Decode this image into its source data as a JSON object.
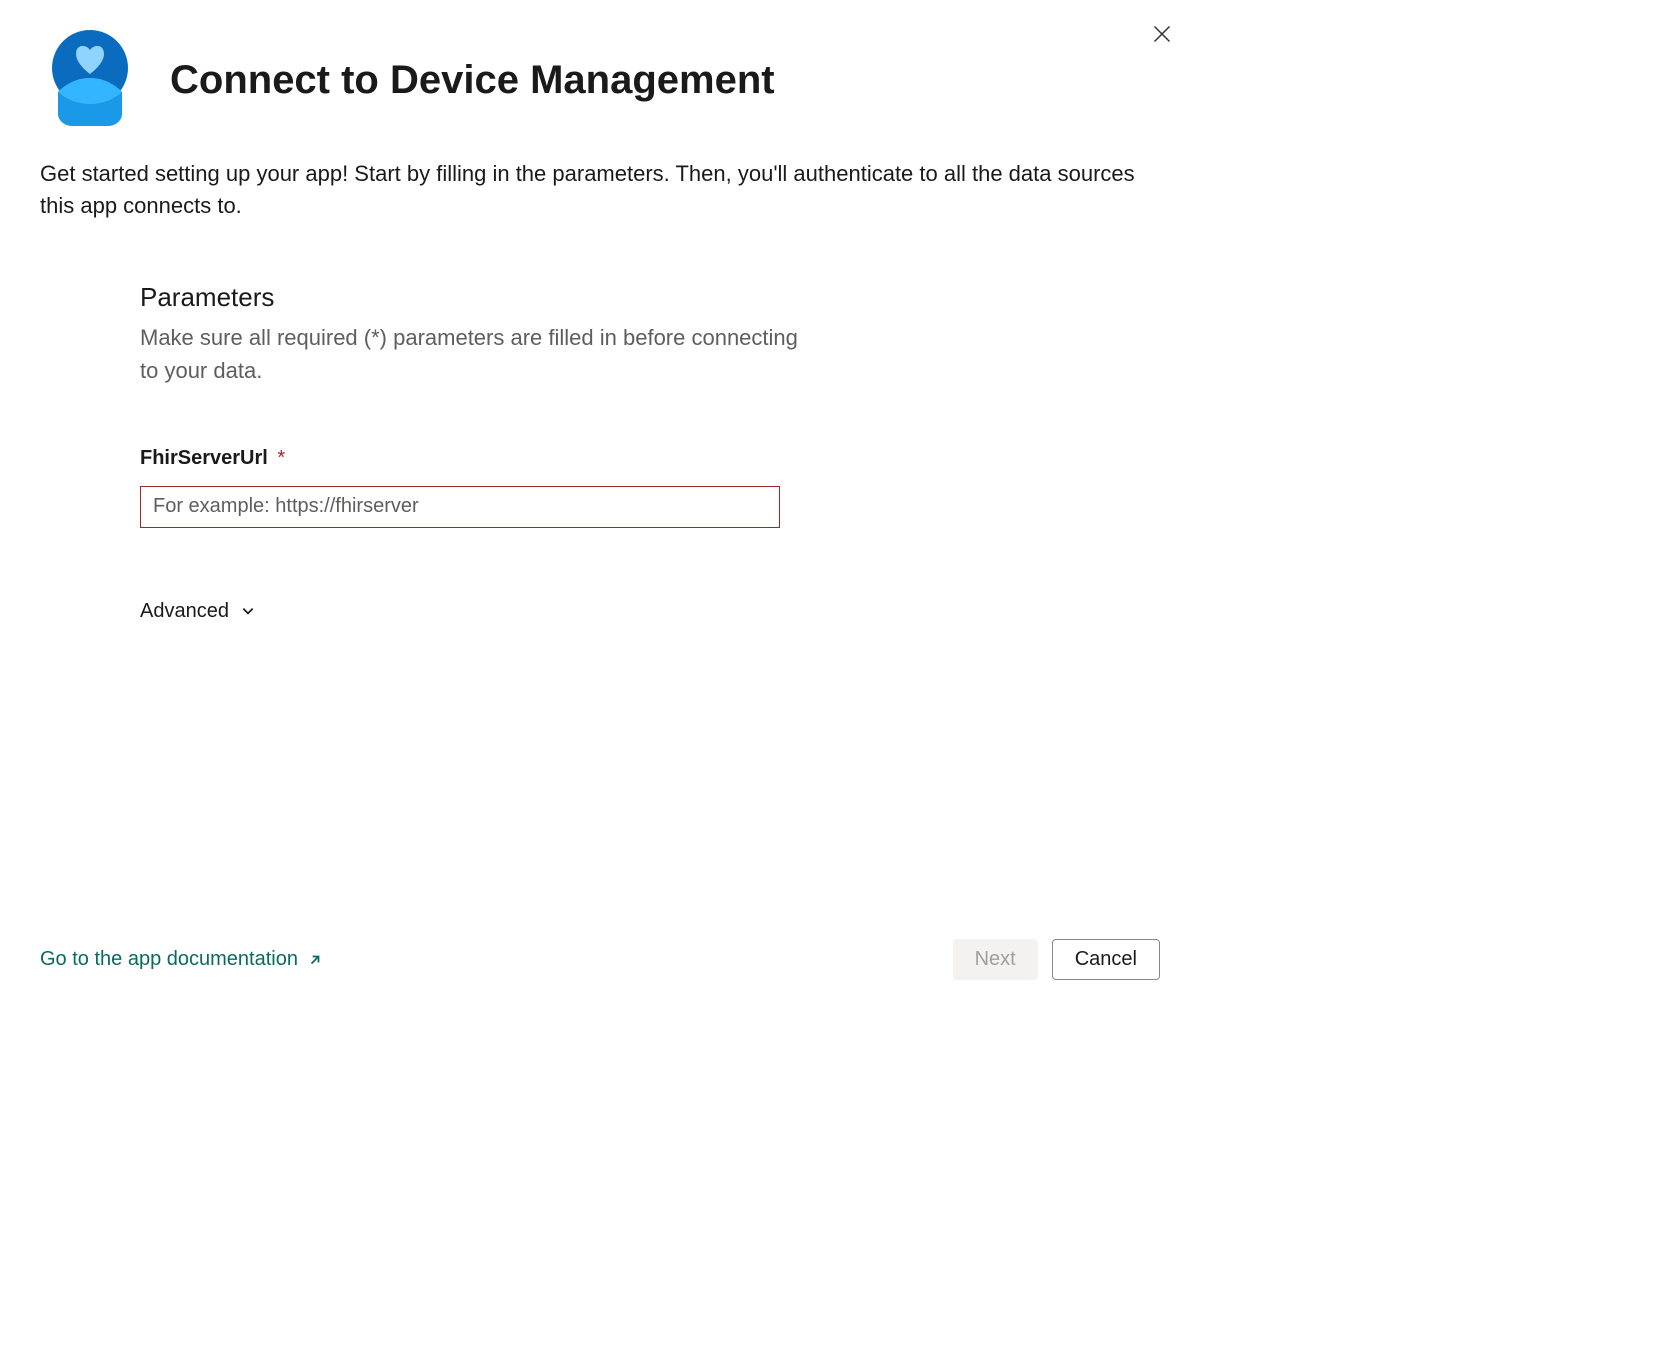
{
  "header": {
    "title": "Connect to Device Management"
  },
  "description": "Get started setting up your app! Start by filling in the parameters. Then, you'll authenticate to all the data sources this app connects to.",
  "parameters": {
    "title": "Parameters",
    "subtitle": "Make sure all required (*) parameters are filled in before connecting to your data.",
    "fields": {
      "fhirServerUrl": {
        "label": "FhirServerUrl",
        "required_marker": "*",
        "placeholder": "For example: https://fhirserver",
        "value": ""
      }
    },
    "advanced_label": "Advanced"
  },
  "footer": {
    "doc_link": "Go to the app documentation",
    "next_label": "Next",
    "cancel_label": "Cancel"
  }
}
